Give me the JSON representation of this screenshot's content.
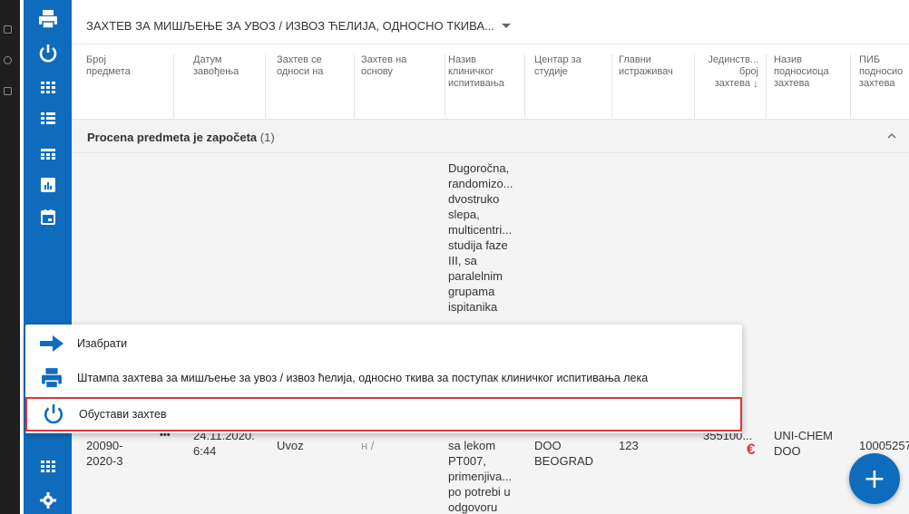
{
  "header": {
    "title": "ЗАХТЕВ ЗА МИШЉЕЊЕ ЗА УВОЗ / ИЗВОЗ ЋЕЛИЈА, ОДНОСНО ТКИВА...",
    "columns": [
      {
        "line1": "Број",
        "line2": "предмета",
        "line3": ""
      },
      {
        "line1": "Датум",
        "line2": "завођења",
        "line3": ""
      },
      {
        "line1": "Захтев се",
        "line2": "односи на",
        "line3": ""
      },
      {
        "line1": "Захтев на",
        "line2": "основу",
        "line3": ""
      },
      {
        "line1": "Назив",
        "line2": "клиничког",
        "line3": "испитивања"
      },
      {
        "line1": "Центар за",
        "line2": "студије",
        "line3": ""
      },
      {
        "line1": "Главни",
        "line2": "истраживач",
        "line3": ""
      },
      {
        "line1": "Јединств...",
        "line2": "број",
        "line3": "захтева"
      },
      {
        "line1": "Назив",
        "line2": "подносиоца",
        "line3": "захтева"
      },
      {
        "line1": "ПИБ",
        "line2": "подносио",
        "line3": "захтева"
      }
    ]
  },
  "group": {
    "title": "Procena predmeta je započeta",
    "count": "(1)"
  },
  "row": {
    "study_name_lines": [
      "Dugoročna,",
      "randomizo...",
      "dvostruko",
      "slepa,",
      "multicentri...",
      "studija faze",
      "III, sa",
      "paralelnim",
      "grupama",
      "ispitanika"
    ],
    "study_name_lower": [
      "sa lekom",
      "PT007,",
      "primenjiva...",
      "po potrebi u",
      "odgovoru"
    ],
    "number_line1": "20090-",
    "number_line2": "2020-3",
    "more": "•••",
    "date_line1": "24.11.2020.",
    "date_line2": "6:44",
    "relates_to": "Uvoz",
    "basis": "н /",
    "center_line1": "DOO",
    "center_line2": "BEOGRAD",
    "investigator": "123",
    "unique_no": "355100...",
    "currency": "€",
    "applicant_line1": "UNI-CHEM",
    "applicant_line2": "DOO",
    "pib": "10005257"
  },
  "menu": {
    "items": [
      {
        "label": "Изабрати",
        "icon": "arrow-right-icon"
      },
      {
        "label": "Штампа захтева за мишљење за увоз / извоз ћелија, односно ткива за поступак клиничког испитивања лека",
        "icon": "printer-icon"
      },
      {
        "label": "Обустави захтев",
        "icon": "power-icon"
      }
    ]
  },
  "fab": {
    "label": "+"
  },
  "colors": {
    "brand": "#0f6cbd",
    "highlight": "#d9363e",
    "currency": "#d9363e"
  }
}
